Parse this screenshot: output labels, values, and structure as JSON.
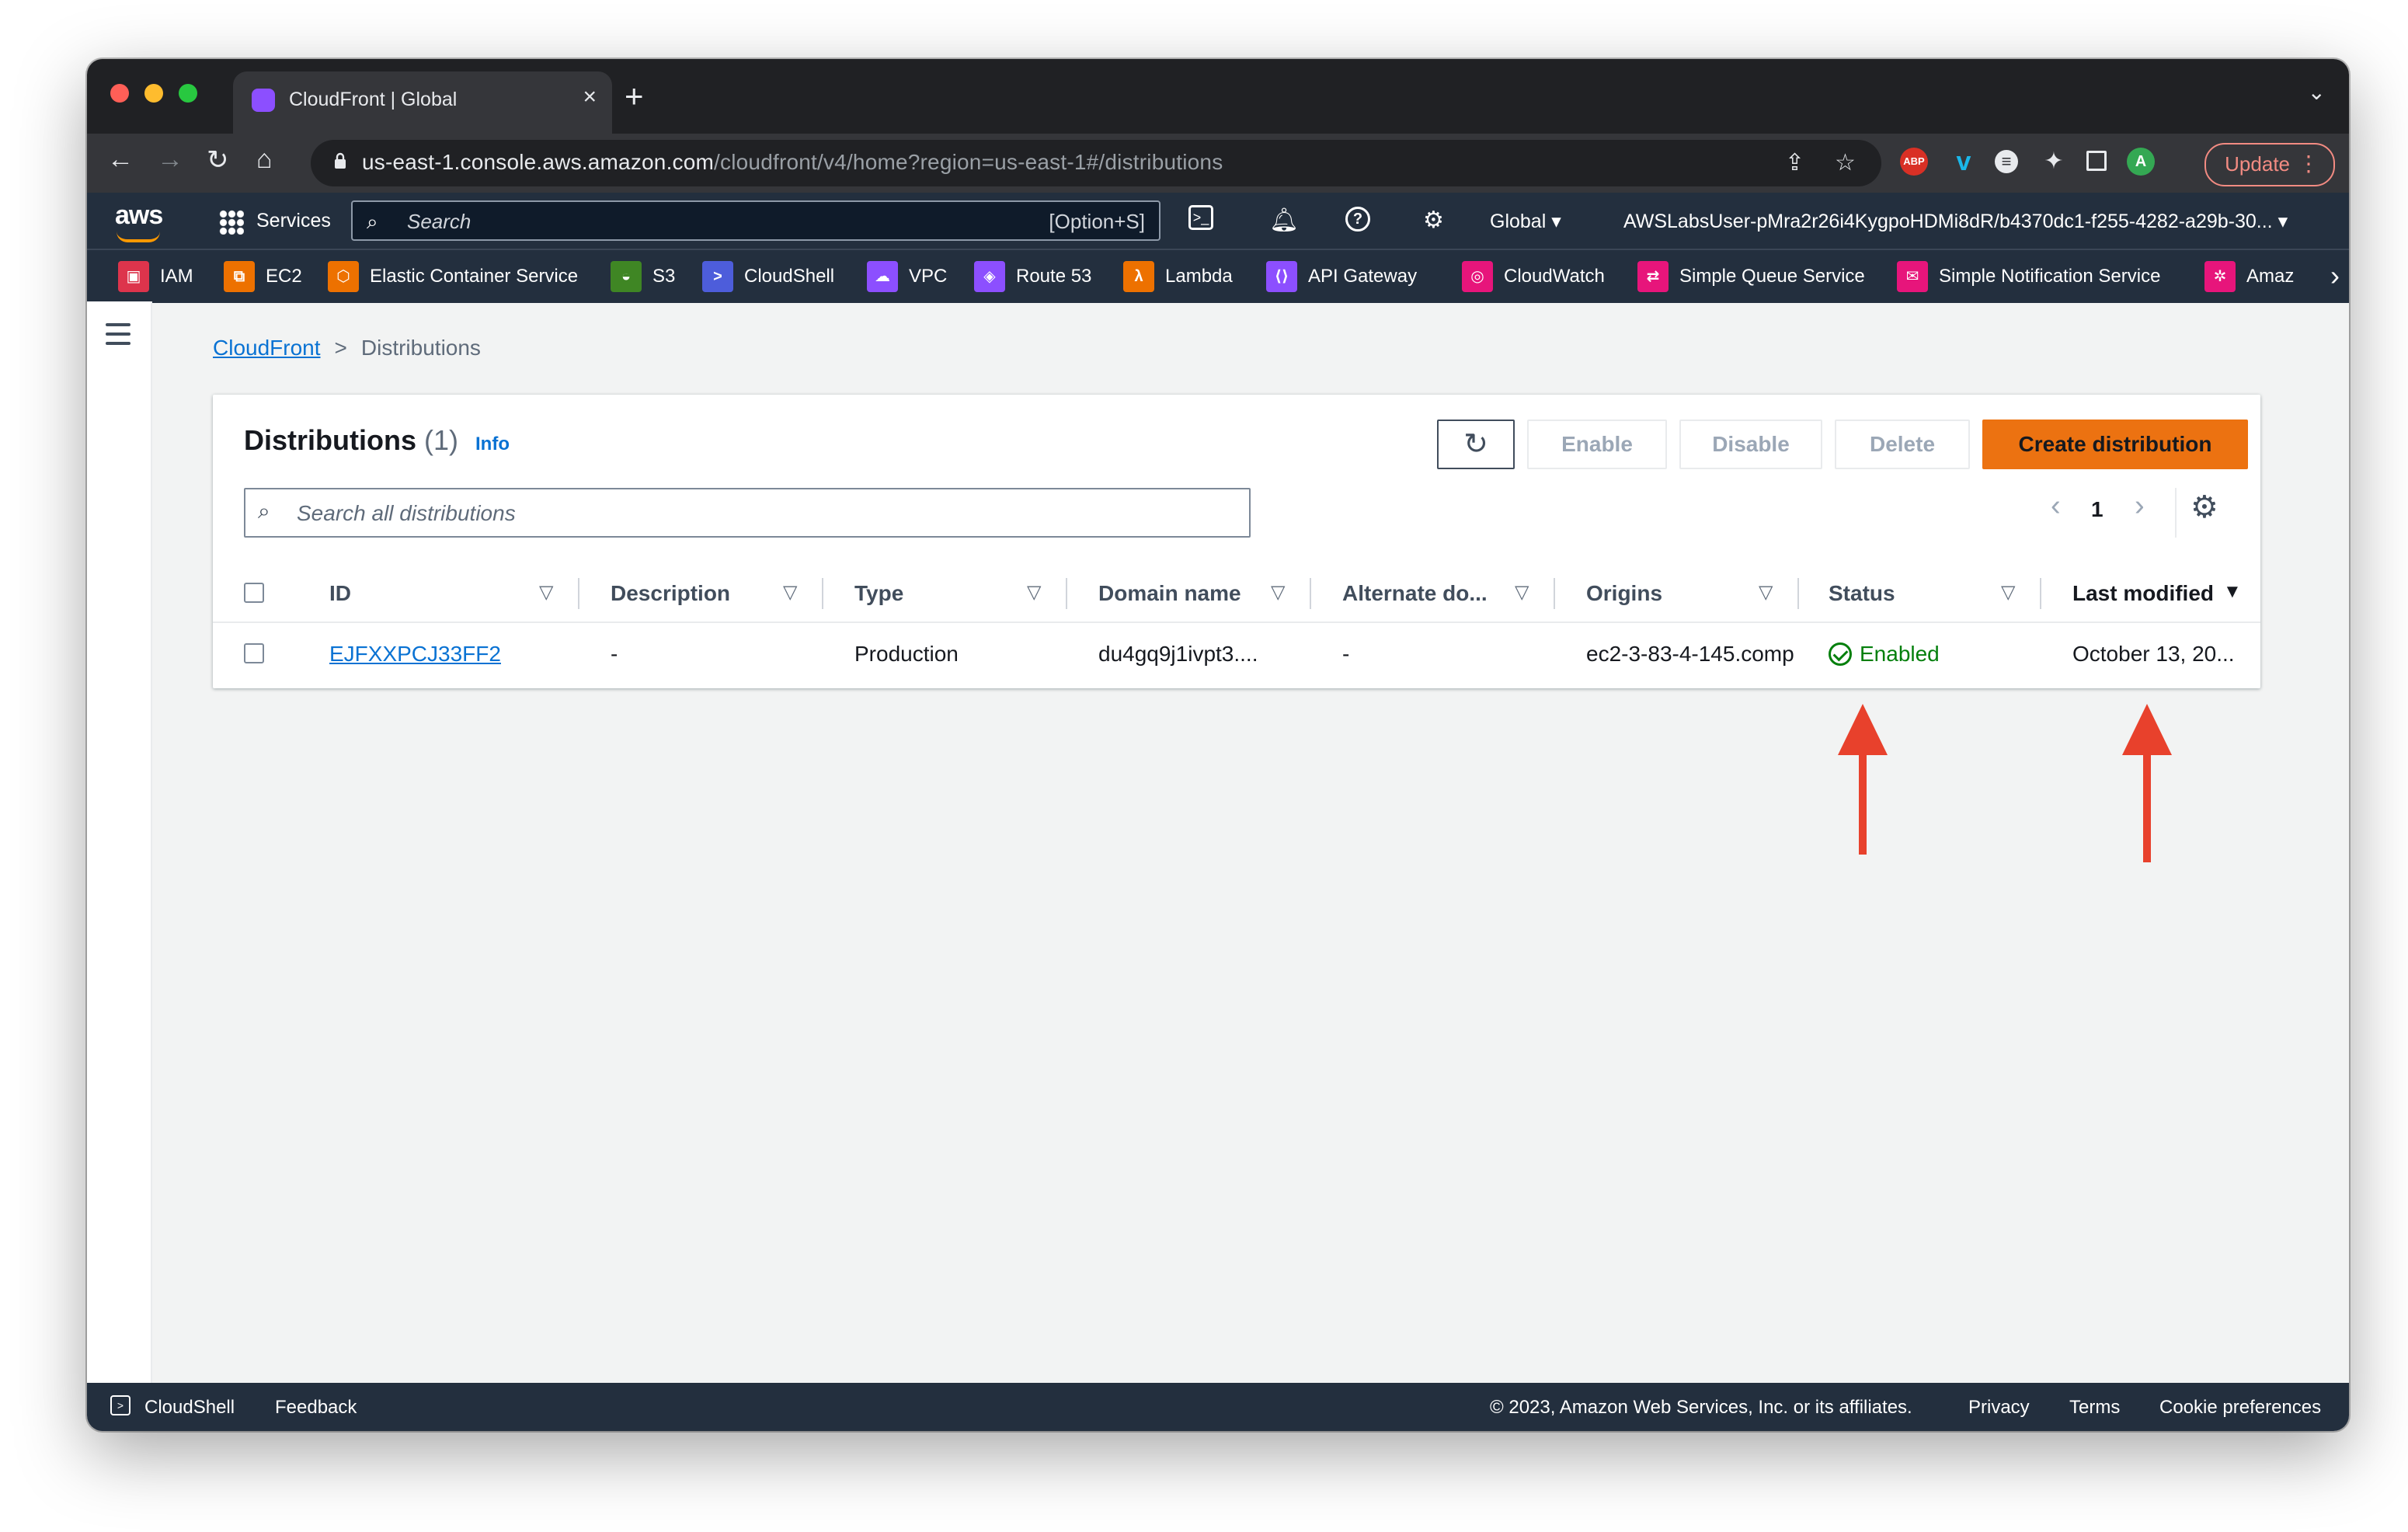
{
  "browser": {
    "tab_title": "CloudFront | Global",
    "url_host": "us-east-1.console.aws.amazon.com",
    "url_path": "/cloudfront/v4/home?region=us-east-1#/distributions",
    "update_label": "Update",
    "profile_initial": "A",
    "abp_label": "ABP"
  },
  "aws_nav": {
    "logo": "aws",
    "services_label": "Services",
    "search_placeholder": "Search",
    "search_shortcut": "[Option+S]",
    "region": "Global",
    "account": "AWSLabsUser-pMra2r26i4KygpoHDMi8dR/b4370dc1-f255-4282-a29b-30..."
  },
  "favorites": [
    {
      "label": "IAM",
      "color": "#dd344c"
    },
    {
      "label": "EC2",
      "color": "#ed7100"
    },
    {
      "label": "Elastic Container Service",
      "color": "#ed7100"
    },
    {
      "label": "S3",
      "color": "#3f8624"
    },
    {
      "label": "CloudShell",
      "color": "#4d5ddb"
    },
    {
      "label": "VPC",
      "color": "#8c4fff"
    },
    {
      "label": "Route 53",
      "color": "#8c4fff"
    },
    {
      "label": "Lambda",
      "color": "#ed7100"
    },
    {
      "label": "API Gateway",
      "color": "#8c4fff"
    },
    {
      "label": "CloudWatch",
      "color": "#e7157b"
    },
    {
      "label": "Simple Queue Service",
      "color": "#e7157b"
    },
    {
      "label": "Simple Notification Service",
      "color": "#e7157b"
    },
    {
      "label": "Amaz",
      "color": "#e7157b"
    }
  ],
  "breadcrumb": {
    "root": "CloudFront",
    "current": "Distributions"
  },
  "panel": {
    "title": "Distributions",
    "count": "(1)",
    "info": "Info",
    "buttons": {
      "enable": "Enable",
      "disable": "Disable",
      "delete": "Delete",
      "create": "Create distribution"
    },
    "search_placeholder": "Search all distributions",
    "page": "1"
  },
  "table": {
    "columns": [
      "ID",
      "Description",
      "Type",
      "Domain name",
      "Alternate do...",
      "Origins",
      "Status",
      "Last modified"
    ],
    "rows": [
      {
        "id": "EJFXXPCJ33FF2",
        "description": "-",
        "type": "Production",
        "domain": "du4gq9j1ivpt3....",
        "alternate": "-",
        "origins": "ec2-3-83-4-145.comp",
        "status": "Enabled",
        "last_modified": "October 13, 20..."
      }
    ]
  },
  "footer": {
    "cloudshell": "CloudShell",
    "feedback": "Feedback",
    "copyright": "© 2023, Amazon Web Services, Inc. or its affiliates.",
    "privacy": "Privacy",
    "terms": "Terms",
    "cookies": "Cookie preferences"
  },
  "colors": {
    "aws_nav_bg": "#232f3e",
    "primary_button": "#ec7211",
    "link": "#0972d3",
    "status_ok": "#037f0c",
    "annotation_arrow": "#e8412c"
  }
}
